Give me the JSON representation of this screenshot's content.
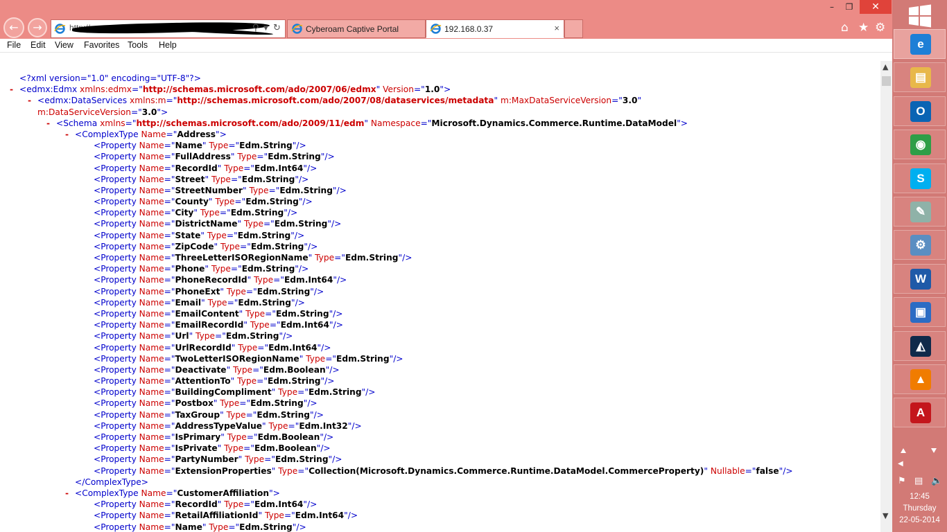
{
  "colors": {
    "titlebar": "#ec8b86",
    "taskbar": "#d27a76",
    "close_button": "#e0433a",
    "xml_tag": "#0000cc",
    "xml_attr": "#cc0000",
    "xml_value": "#000000"
  },
  "browser": {
    "back_icon": "back-arrow-icon",
    "forward_icon": "forward-arrow-icon",
    "address_url": "http://",
    "tabs": [
      {
        "label": "Cyberoam Captive Portal",
        "active": false
      },
      {
        "label": "192.168.0.37",
        "active": true,
        "close": "×"
      }
    ],
    "window_controls": {
      "minimize": "–",
      "maximize": "❐",
      "close": "✕"
    },
    "toolbar_icons": [
      "home-icon",
      "star-icon",
      "gear-icon"
    ],
    "menu": [
      "File",
      "Edit",
      "View",
      "Favorites",
      "Tools",
      "Help"
    ]
  },
  "xml": {
    "declaration": "<?xml version=\"1.0\" encoding=\"UTF-8\"?>",
    "edmx_tag": "edmx:Edmx",
    "edmx_xmlns_attr": "xmlns:edmx",
    "edmx_xmlns_val": "http://schemas.microsoft.com/ado/2007/06/edmx",
    "edmx_version_attr": "Version",
    "edmx_version_val": "1.0",
    "ds_tag": "edmx:DataServices",
    "ds_xmlns_attr": "xmlns:m",
    "ds_xmlns_val": "http://schemas.microsoft.com/ado/2007/08/dataservices/metadata",
    "ds_maxver_attr": "m:MaxDataServiceVersion",
    "ds_maxver_val": "3.0",
    "ds_ver_attr": "m:DataServiceVersion",
    "ds_ver_val": "3.0",
    "schema_tag": "Schema",
    "schema_xmlns_attr": "xmlns",
    "schema_xmlns_val": "http://schemas.microsoft.com/ado/2009/11/edm",
    "schema_ns_attr": "Namespace",
    "schema_ns_val": "Microsoft.Dynamics.Commerce.Runtime.DataModel",
    "complex_tag": "ComplexType",
    "name_attr": "Name",
    "type_attr": "Type",
    "nullable_attr": "Nullable",
    "property_tag": "Property",
    "toggle": "-",
    "complex_types": [
      {
        "name": "Address",
        "closed": true,
        "properties": [
          {
            "name": "Name",
            "type": "Edm.String"
          },
          {
            "name": "FullAddress",
            "type": "Edm.String"
          },
          {
            "name": "RecordId",
            "type": "Edm.Int64"
          },
          {
            "name": "Street",
            "type": "Edm.String"
          },
          {
            "name": "StreetNumber",
            "type": "Edm.String"
          },
          {
            "name": "County",
            "type": "Edm.String"
          },
          {
            "name": "City",
            "type": "Edm.String"
          },
          {
            "name": "DistrictName",
            "type": "Edm.String"
          },
          {
            "name": "State",
            "type": "Edm.String"
          },
          {
            "name": "ZipCode",
            "type": "Edm.String"
          },
          {
            "name": "ThreeLetterISORegionName",
            "type": "Edm.String"
          },
          {
            "name": "Phone",
            "type": "Edm.String"
          },
          {
            "name": "PhoneRecordId",
            "type": "Edm.Int64"
          },
          {
            "name": "PhoneExt",
            "type": "Edm.String"
          },
          {
            "name": "Email",
            "type": "Edm.String"
          },
          {
            "name": "EmailContent",
            "type": "Edm.String"
          },
          {
            "name": "EmailRecordId",
            "type": "Edm.Int64"
          },
          {
            "name": "Url",
            "type": "Edm.String"
          },
          {
            "name": "UrlRecordId",
            "type": "Edm.Int64"
          },
          {
            "name": "TwoLetterISORegionName",
            "type": "Edm.String"
          },
          {
            "name": "Deactivate",
            "type": "Edm.Boolean"
          },
          {
            "name": "AttentionTo",
            "type": "Edm.String"
          },
          {
            "name": "BuildingCompliment",
            "type": "Edm.String"
          },
          {
            "name": "Postbox",
            "type": "Edm.String"
          },
          {
            "name": "TaxGroup",
            "type": "Edm.String"
          },
          {
            "name": "AddressTypeValue",
            "type": "Edm.Int32"
          },
          {
            "name": "IsPrimary",
            "type": "Edm.Boolean"
          },
          {
            "name": "IsPrivate",
            "type": "Edm.Boolean"
          },
          {
            "name": "PartyNumber",
            "type": "Edm.String"
          },
          {
            "name": "ExtensionProperties",
            "type": "Collection(Microsoft.Dynamics.Commerce.Runtime.DataModel.CommerceProperty)",
            "nullable": "false"
          }
        ]
      },
      {
        "name": "CustomerAffiliation",
        "closed": false,
        "properties": [
          {
            "name": "RecordId",
            "type": "Edm.Int64"
          },
          {
            "name": "RetailAffiliationId",
            "type": "Edm.Int64"
          },
          {
            "name": "Name",
            "type": "Edm.String"
          }
        ]
      }
    ]
  },
  "taskbar": {
    "start_icon": "windows-logo-icon",
    "apps": [
      {
        "icon": "internet-explorer-icon",
        "active": true,
        "color": "#1e7fd6",
        "glyph": "e"
      },
      {
        "icon": "file-explorer-icon",
        "active": false,
        "color": "#e8b84a",
        "glyph": "▤"
      },
      {
        "icon": "outlook-icon",
        "active": false,
        "color": "#0a64b4",
        "glyph": "O"
      },
      {
        "icon": "chrome-icon",
        "active": false,
        "color": "#2e9e47",
        "glyph": "◉"
      },
      {
        "icon": "skype-icon",
        "active": false,
        "color": "#00aff0",
        "glyph": "S"
      },
      {
        "icon": "notes-app-icon",
        "active": false,
        "color": "#8fb2a8",
        "glyph": "✎"
      },
      {
        "icon": "settings-gears-icon",
        "active": false,
        "color": "#5a8ec2",
        "glyph": "⚙"
      },
      {
        "icon": "word-icon",
        "active": false,
        "color": "#1f5aa8",
        "glyph": "W"
      },
      {
        "icon": "remote-desktop-icon",
        "active": false,
        "color": "#2b6cc4",
        "glyph": "▣"
      },
      {
        "icon": "dynamics-icon",
        "active": false,
        "color": "#0f2a4a",
        "glyph": "◭"
      },
      {
        "icon": "vlc-icon",
        "active": false,
        "color": "#f07c00",
        "glyph": "▲"
      },
      {
        "icon": "acrobat-icon",
        "active": false,
        "color": "#c4161c",
        "glyph": "A"
      }
    ],
    "tray_icons": [
      "network-error-icon",
      "network-icon",
      "volume-icon"
    ],
    "clock": {
      "time": "12:45",
      "day": "Thursday",
      "date": "22-05-2014"
    }
  }
}
